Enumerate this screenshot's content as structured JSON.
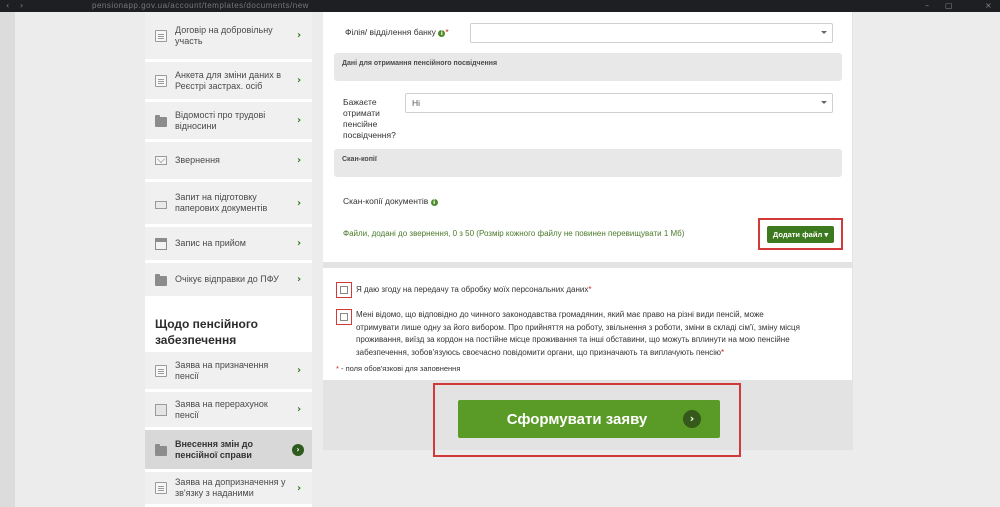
{
  "browser": {
    "url": "pensionapp.gov.ua/account/templates/documents/new"
  },
  "sidebar": {
    "items": [
      {
        "label": "Договір на добровільну участь",
        "icon": "document-icon"
      },
      {
        "label": "Анкета для зміни даних в Реєстрі застрах. осіб",
        "icon": "document-icon"
      },
      {
        "label": "Відомості про трудові відносини",
        "icon": "folder-icon"
      },
      {
        "label": "Звернення",
        "icon": "mail-icon"
      },
      {
        "label": "Запит на підготовку паперових документів",
        "icon": "printer-icon"
      },
      {
        "label": "Запис на прийом",
        "icon": "calendar-icon"
      },
      {
        "label": "Очікує відправки до ПФУ",
        "icon": "folder-icon"
      }
    ],
    "section_heading": "Щодо пенсійного забезпечення",
    "pension_items": [
      {
        "label": "Заява на призначення пенсії",
        "icon": "document-icon"
      },
      {
        "label": "Заява на перерахунок пенсії",
        "icon": "stack-icon"
      },
      {
        "label": "Внесення змін до пенсійної справи",
        "icon": "folder-icon",
        "active": true
      },
      {
        "label": "Заява на допризначення у зв'язку з наданими",
        "icon": "document-icon"
      }
    ],
    "chevron": "›"
  },
  "form": {
    "bank_branch_label": "Філія/ відділення банку",
    "bank_branch_value": "",
    "certificate_section": "Дані для отримання пенсійного посвідчення",
    "want_certificate_label": "Бажаєте отримати пенсійне посвідчення?",
    "want_certificate_value": "Ні",
    "scans_section": "Скан-копії",
    "scans_label": "Скан-копії документів",
    "files_note": "Файли, додані до звернення, 0 з 50 (Розмір кожного файлу не повинен перевищувати 1 Мб)",
    "add_file_label": "Додати файл",
    "required_mark": "*",
    "info_glyph": "i"
  },
  "consents": {
    "personal_data": "Я даю згоду на передачу та обробку моїх персональних даних",
    "awareness": "Мені відомо, що відповідно до чинного законодавства громадянин, який має право на різні види пенсій, може отримувати лише одну за його вибором. Про прийняття на роботу, звільнення з роботи, зміни в складі сім'ї, зміну місця проживання, виїзд за кордон на постійне місце проживання та інші обставини, що можуть вплинути на мою пенсійне забезпечення, зобов'язуюсь своєчасно повідомити органи, що призначають та виплачують пенсію",
    "required_note": " - поля обов'язкові для заповнення"
  },
  "submit": {
    "label": "Сформувати заяву",
    "arrow": "›"
  },
  "colors": {
    "accent_green": "#5a9a26",
    "dark_green": "#3d7a1f",
    "highlight_red": "#d23a3a"
  }
}
